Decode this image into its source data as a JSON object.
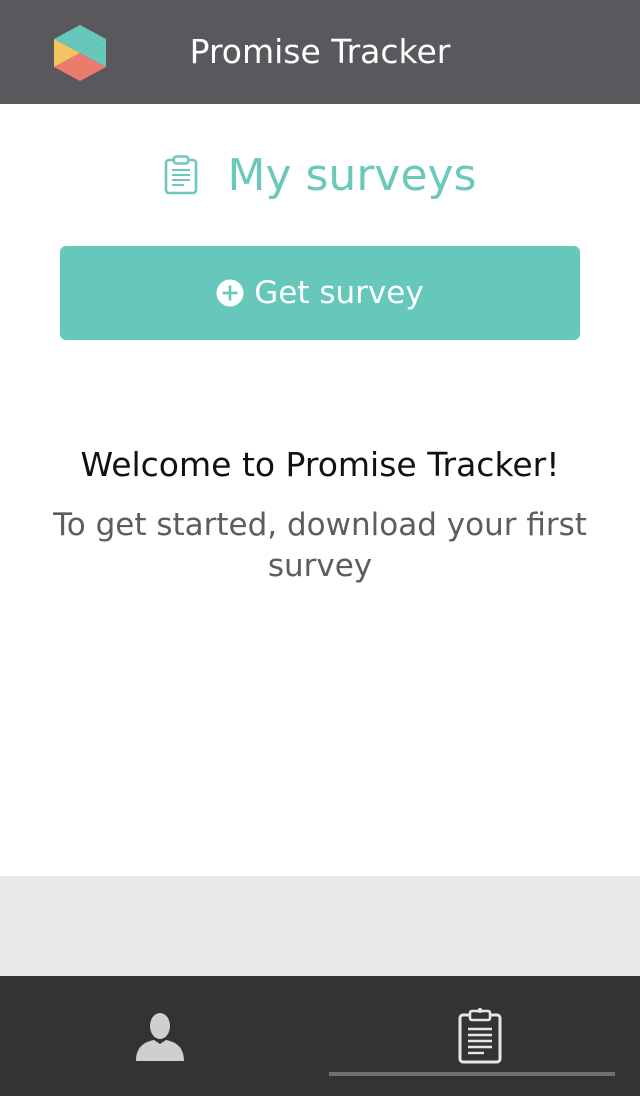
{
  "header": {
    "app_title": "Promise Tracker",
    "logo_icon": "hexagon-logo-icon"
  },
  "main": {
    "section_title": "My surveys",
    "section_icon": "clipboard-icon",
    "get_survey_label": "Get survey",
    "get_survey_icon": "plus-circle-icon",
    "welcome_title": "Welcome to Promise Tracker!",
    "welcome_text": "To get started, download your first survey"
  },
  "bottom_nav": {
    "tabs": [
      {
        "icon": "person-icon",
        "selected": false
      },
      {
        "icon": "clipboard-icon",
        "selected": true
      }
    ]
  },
  "colors": {
    "header_bg": "#59585d",
    "accent": "#66c8ba",
    "nav_bg": "#333333",
    "logo_teal": "#66c8ba",
    "logo_yellow": "#f5c45e",
    "logo_red": "#ec7b6e"
  }
}
